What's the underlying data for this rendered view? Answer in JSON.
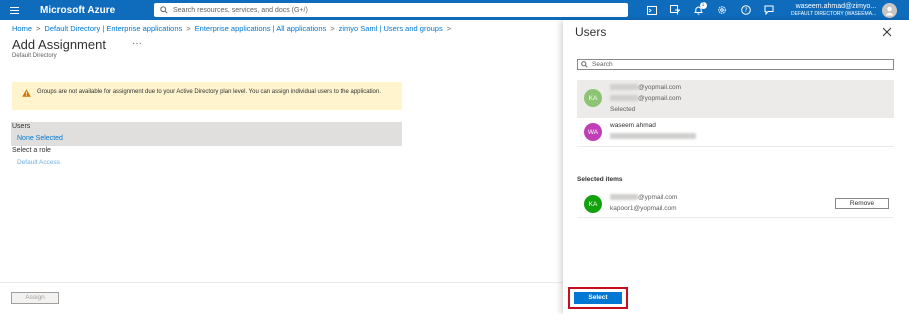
{
  "topbar": {
    "brand": "Microsoft Azure",
    "search_placeholder": "Search resources, services, and docs (G+/)",
    "notification_count": "1",
    "user": "waseem.ahmad@zimyo...",
    "directory": "DEFAULT DIRECTORY (WASEEMA..."
  },
  "breadcrumb": [
    "Home",
    "Default Directory | Enterprise applications",
    "Enterprise applications | All applications",
    "zimyo Saml | Users and groups"
  ],
  "page": {
    "title": "Add Assignment",
    "subtitle": "Default Directory",
    "warning": "Groups are not available for assignment due to your Active Directory plan level. You can assign individual users to the application.",
    "users_label": "Users",
    "users_value": "None Selected",
    "role_label": "Select a role",
    "role_value": "Default Access",
    "assign_label": "Assign"
  },
  "panel": {
    "title": "Users",
    "search_placeholder": "Search",
    "results": [
      {
        "initials": "KA",
        "line1": "@yopmail.com",
        "line2": "@yopmail.com",
        "status": "Selected",
        "avatar_color": "#8cc474"
      },
      {
        "initials": "WA",
        "name": "waseem ahmad",
        "avatar_color": "#c13fb5"
      }
    ],
    "selected_title": "Selected items",
    "selected": [
      {
        "initials": "KA",
        "line1": "@ypmail.com",
        "line2": "kapoor1@yopmail.com",
        "avatar_color": "#13a10e"
      }
    ],
    "remove_label": "Remove",
    "select_label": "Select"
  },
  "colors": {
    "azure_blue": "#0f6cbd",
    "link": "#0078d4",
    "warning_bg": "#fff4ce",
    "highlight": "#c50f1f"
  }
}
